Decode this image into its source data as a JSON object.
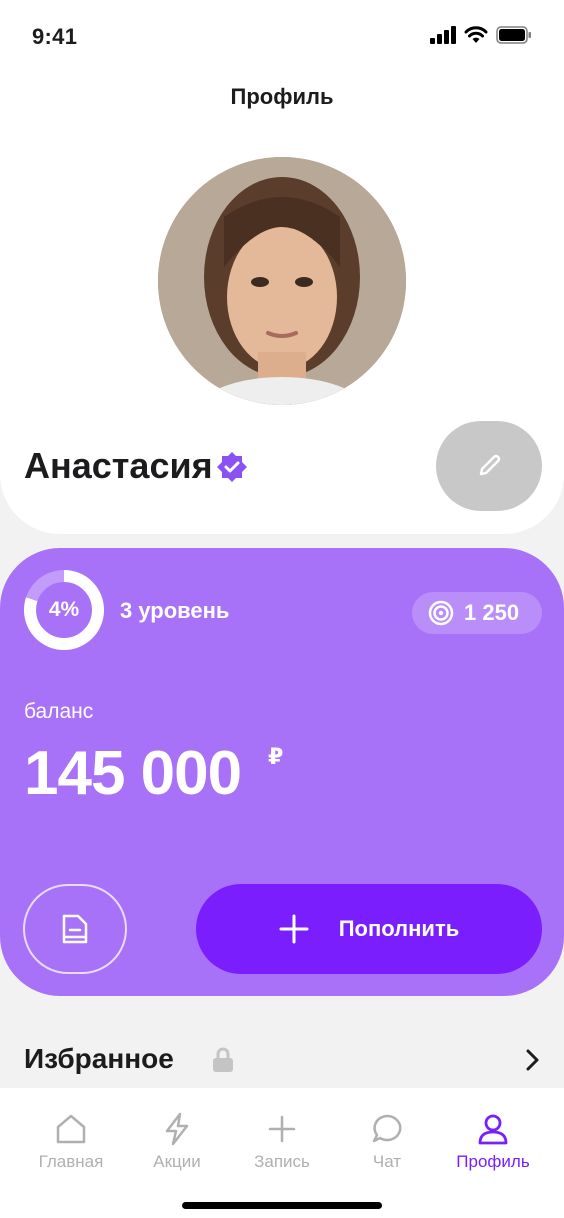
{
  "status_bar": {
    "time": "9:41"
  },
  "header": {
    "title": "Профиль"
  },
  "profile": {
    "name": "Анастасия",
    "verified": true,
    "avatar_icon": "user-photo"
  },
  "balance_card": {
    "level_percent": "4%",
    "level_progress": 0.04,
    "level_label": "3 уровень",
    "points": "1 250",
    "balance_label": "баланс",
    "balance_amount": "145 000",
    "currency": "₽",
    "topup_label": "Пополнить"
  },
  "favorites": {
    "title": "Избранное"
  },
  "tabs": [
    {
      "label": "Главная",
      "icon": "home-icon",
      "active": false
    },
    {
      "label": "Акции",
      "icon": "lightning-icon",
      "active": false
    },
    {
      "label": "Запись",
      "icon": "plus-icon",
      "active": false
    },
    {
      "label": "Чат",
      "icon": "chat-icon",
      "active": false
    },
    {
      "label": "Профиль",
      "icon": "person-icon",
      "active": true
    }
  ],
  "colors": {
    "accent": "#7a1efd",
    "card": "#a872f8",
    "background": "#f2f2f2"
  }
}
